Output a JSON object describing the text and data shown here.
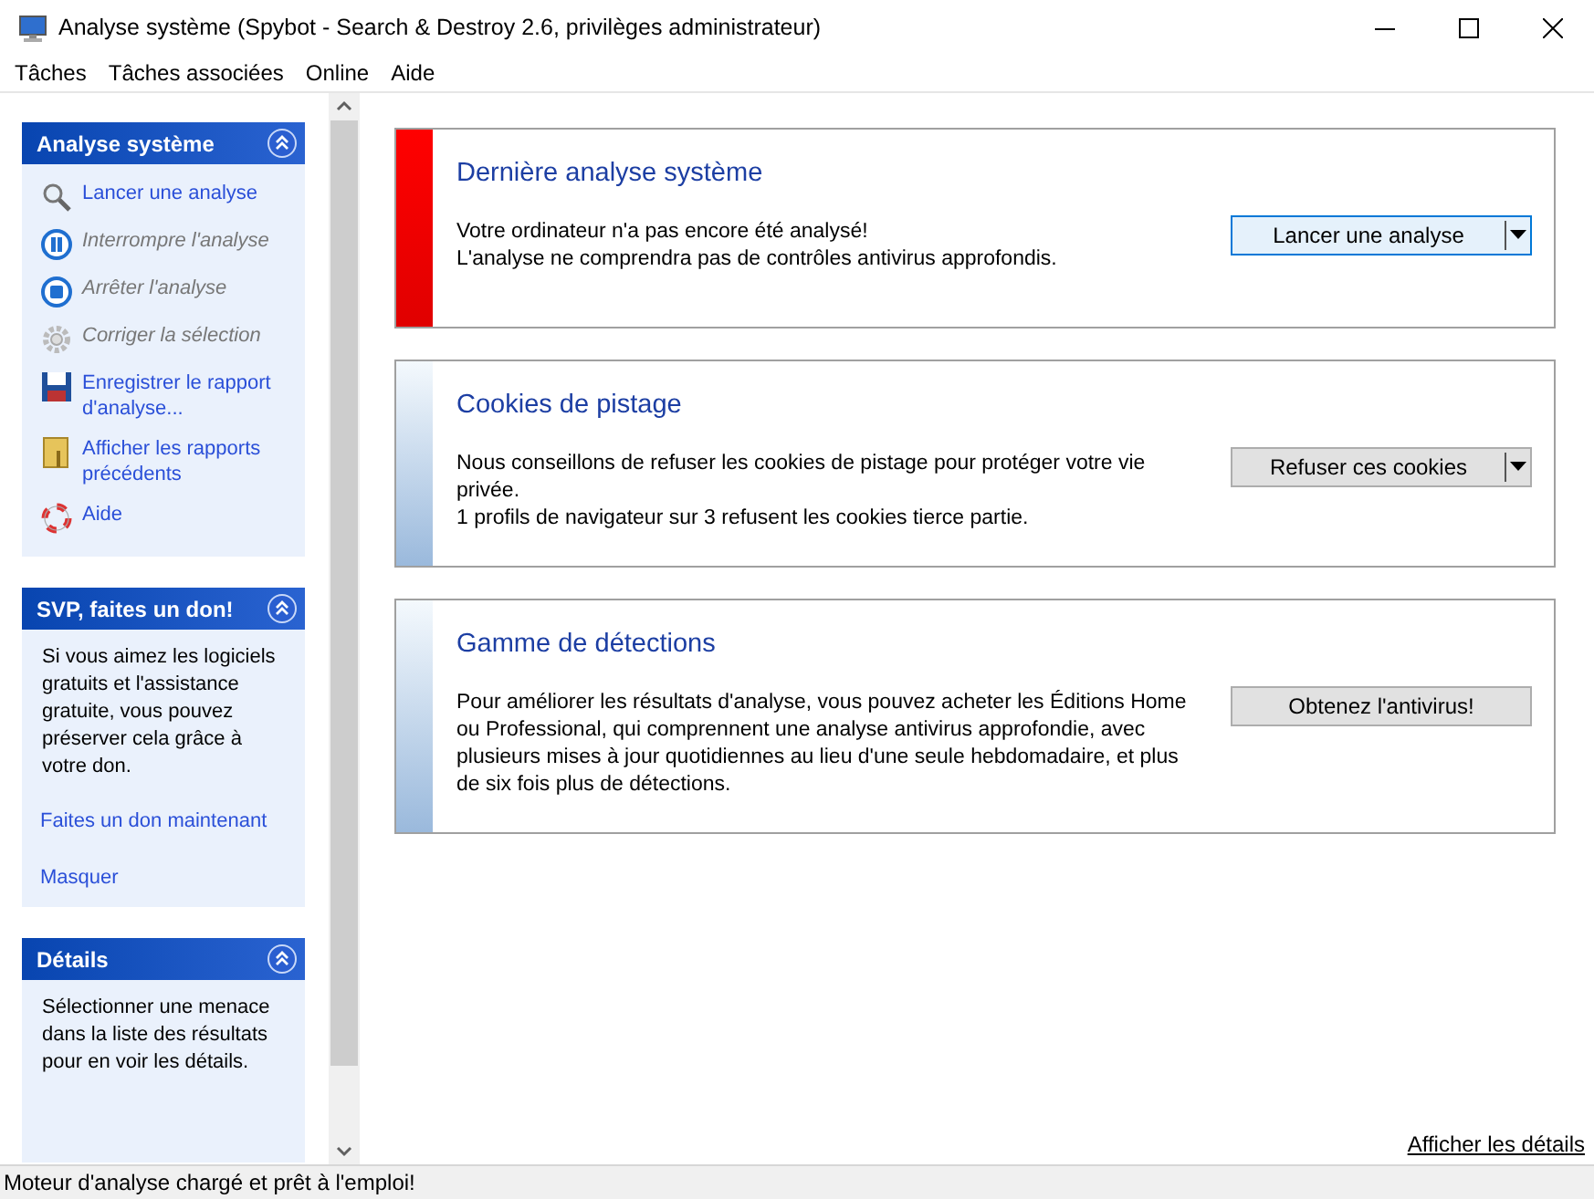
{
  "window": {
    "title": "Analyse système (Spybot - Search & Destroy 2.6, privilèges administrateur)"
  },
  "menu": [
    "Tâches",
    "Tâches associées",
    "Online",
    "Aide"
  ],
  "sidebar": [
    {
      "title": "Analyse système",
      "items": [
        {
          "label": "Lancer une analyse",
          "disabled": false
        },
        {
          "label": "Interrompre l'analyse",
          "disabled": true
        },
        {
          "label": "Arrêter l'analyse",
          "disabled": true
        },
        {
          "label": "Corriger la sélection",
          "disabled": true
        },
        {
          "label": "Enregistrer le rapport d'analyse...",
          "disabled": false
        },
        {
          "label": "Afficher les rapports précédents",
          "disabled": false
        },
        {
          "label": "Aide",
          "disabled": false
        }
      ]
    },
    {
      "title": "SVP, faites un don!",
      "text": "Si vous aimez les logiciels gratuits et l'assistance gratuite, vous pouvez préserver cela grâce à votre don.",
      "links": [
        "Faites un don maintenant",
        "Masquer"
      ]
    },
    {
      "title": "Détails",
      "text": "Sélectionner une menace dans la liste des résultats pour en voir les détails."
    }
  ],
  "cards": [
    {
      "kind": "alert",
      "title": "Dernière analyse système",
      "lines": [
        "Votre ordinateur n'a pas encore été analysé!",
        "L'analyse ne comprendra pas de contrôles antivirus approfondis."
      ],
      "button": {
        "label": "Lancer une analyse",
        "dropdown": true,
        "focused": true
      }
    },
    {
      "kind": "info",
      "title": "Cookies de pistage",
      "lines": [
        "Nous conseillons de refuser les cookies de pistage pour protéger votre vie privée.",
        "1 profils de navigateur sur 3 refusent les cookies tierce partie."
      ],
      "button": {
        "label": "Refuser ces cookies",
        "dropdown": true,
        "focused": false
      }
    },
    {
      "kind": "info",
      "title": "Gamme de détections",
      "lines": [
        "Pour améliorer les résultats d'analyse, vous pouvez acheter les Éditions Home ou Professional, qui comprennent une analyse antivirus approfondie, avec plusieurs mises à jour quotidiennes au lieu d'une seule hebdomadaire, et plus de six fois plus de détections."
      ],
      "button": {
        "label": "Obtenez l'antivirus!",
        "dropdown": false,
        "focused": false
      }
    }
  ],
  "details_link": "Afficher les détails",
  "status_bar": "Moteur d'analyse chargé et prêt à l'emploi!"
}
